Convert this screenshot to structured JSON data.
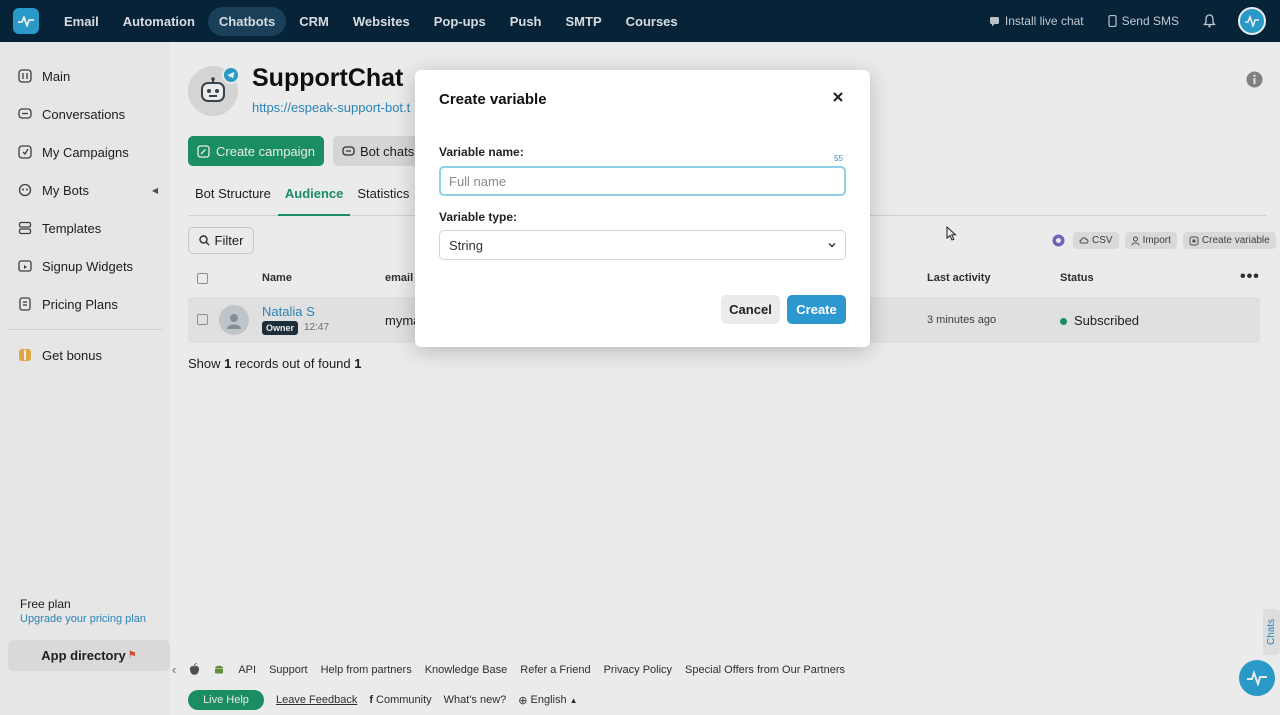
{
  "topnav": {
    "items": [
      "Email",
      "Automation",
      "Chatbots",
      "CRM",
      "Websites",
      "Pop-ups",
      "Push",
      "SMTP",
      "Courses"
    ],
    "active": "Chatbots",
    "install_live_chat": "Install live chat",
    "send_sms": "Send SMS"
  },
  "sidebar": {
    "items": [
      {
        "label": "Main",
        "icon": "sliders-icon"
      },
      {
        "label": "Conversations",
        "icon": "chat-icon"
      },
      {
        "label": "My Campaigns",
        "icon": "campaign-icon"
      },
      {
        "label": "My Bots",
        "icon": "bot-icon"
      },
      {
        "label": "Templates",
        "icon": "templates-icon"
      },
      {
        "label": "Signup Widgets",
        "icon": "widget-icon"
      },
      {
        "label": "Pricing Plans",
        "icon": "pricing-icon"
      }
    ],
    "get_bonus": "Get bonus",
    "free_plan": "Free plan",
    "upgrade": "Upgrade your pricing plan",
    "app_directory": "App directory"
  },
  "bot": {
    "title": "SupportChat",
    "url": "https://espeak-support-bot.t"
  },
  "actions": {
    "create_campaign": "Create campaign",
    "bot_chats": "Bot chats"
  },
  "tabs": [
    "Bot Structure",
    "Audience",
    "Statistics"
  ],
  "active_tab": "Audience",
  "filter_label": "Filter",
  "tools": {
    "csv": "CSV",
    "import": "Import",
    "create_variable": "Create variable"
  },
  "table": {
    "headers": {
      "name": "Name",
      "email": "email",
      "last_activity": "Last activity",
      "status": "Status"
    },
    "rows": [
      {
        "name": "Natalia S",
        "badge": "Owner",
        "time": "12:47",
        "email": "myma",
        "last_activity": "3 minutes ago",
        "status": "Subscribed"
      }
    ]
  },
  "records": {
    "show": "Show",
    "count": "1",
    "middle": "records out of found",
    "found": "1"
  },
  "footer": {
    "links": [
      "API",
      "Support",
      "Help from partners",
      "Knowledge Base",
      "Refer a Friend",
      "Privacy Policy",
      "Special Offers from Our Partners"
    ],
    "live_help": "Live Help",
    "leave_feedback": "Leave Feedback",
    "community": "Community",
    "whats_new": "What's new?",
    "language": "English"
  },
  "chats_tab": "Chats",
  "modal": {
    "title": "Create variable",
    "name_label": "Variable name:",
    "char_count": "55",
    "name_placeholder": "Full name",
    "type_label": "Variable type:",
    "type_value": "String",
    "cancel": "Cancel",
    "create": "Create"
  },
  "colors": {
    "topbar": "#08263d",
    "accent_green": "#1e9a6c",
    "accent_blue": "#2d97cf"
  }
}
